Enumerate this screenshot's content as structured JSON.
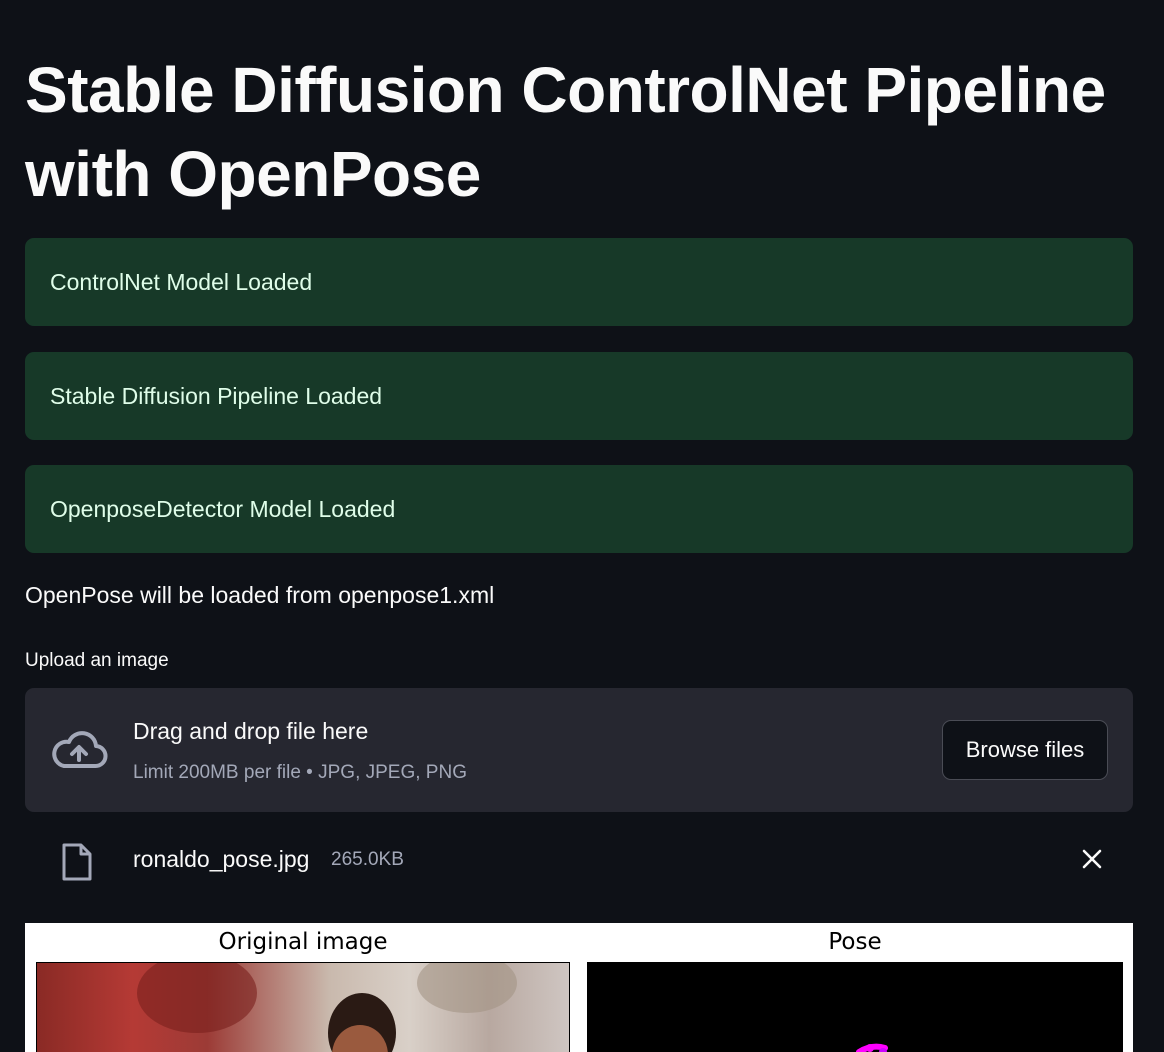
{
  "title": "Stable Diffusion ControlNet Pipeline with OpenPose",
  "alerts": [
    {
      "text": "ControlNet Model Loaded"
    },
    {
      "text": "Stable Diffusion Pipeline Loaded"
    },
    {
      "text": "OpenposeDetector Model Loaded"
    }
  ],
  "info_text": "OpenPose will be loaded from openpose1.xml",
  "uploader": {
    "label": "Upload an image",
    "drop_title": "Drag and drop file here",
    "limit_text": "Limit 200MB per file • JPG, JPEG, PNG",
    "browse_label": "Browse files",
    "icon": "cloud-upload-icon"
  },
  "uploaded_file": {
    "name": "ronaldo_pose.jpg",
    "size": "265.0KB",
    "icon": "file-icon"
  },
  "figure": {
    "left_title": "Original image",
    "right_title": "Pose"
  },
  "colors": {
    "background": "#0e1117",
    "success_bg": "#173928",
    "success_text": "#dffde9",
    "dropzone_bg": "#262730",
    "pose_keypoint": "#ff00ff"
  }
}
